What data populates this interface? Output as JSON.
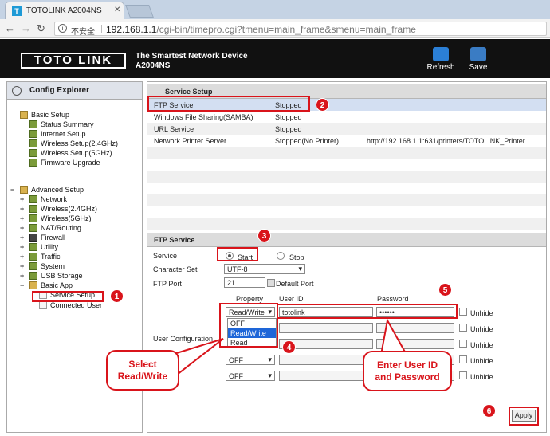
{
  "browser": {
    "tab_logo": "T",
    "tab_title": "TOTOLINK A2004NS",
    "tab_close": "✕",
    "security_label": "不安全",
    "url_host": "192.168.1.1",
    "url_path": "/cgi-bin/timepro.cgi?tmenu=main_frame&smenu=main_frame"
  },
  "header": {
    "logo": "TOTO LINK",
    "slogan": "The Smartest Network Device",
    "model": "A2004NS",
    "refresh_label": "Refresh",
    "save_label": "Save"
  },
  "sidebar": {
    "title": "Config Explorer",
    "basic_setup": "Basic Setup",
    "basic_items": [
      "Status Summary",
      "Internet Setup",
      "Wireless Setup(2.4GHz)",
      "Wireless Setup(5GHz)",
      "Firmware Upgrade"
    ],
    "advanced_setup": "Advanced Setup",
    "advanced_items": [
      "Network",
      "Wireless(2.4GHz)",
      "Wireless(5GHz)",
      "NAT/Routing",
      "Firewall",
      "Utility",
      "Traffic",
      "System",
      "USB Storage"
    ],
    "basic_app": "Basic App",
    "app_items": [
      "Service Setup",
      "Connected User"
    ],
    "plus": "+",
    "minus": "−"
  },
  "service_setup": {
    "title": "Service Setup",
    "rows": [
      {
        "name": "FTP Service",
        "status": "Stopped",
        "extra": ""
      },
      {
        "name": "Windows File Sharing(SAMBA)",
        "status": "Stopped",
        "extra": ""
      },
      {
        "name": "URL Service",
        "status": "Stopped",
        "extra": ""
      },
      {
        "name": "Network Printer Server",
        "status": "Stopped(No Printer)",
        "extra": "http://192.168.1.1:631/printers/TOTOLINK_Printer"
      }
    ]
  },
  "ftp": {
    "title": "FTP Service",
    "service_label": "Service",
    "start_label": "Start",
    "stop_label": "Stop",
    "charset_label": "Character Set",
    "charset_value": "UTF-8",
    "port_label": "FTP Port",
    "port_value": "21",
    "default_port_label": "Default Port",
    "col_property": "Property",
    "col_userid": "User ID",
    "col_password": "Password",
    "user_config_label": "User Configuration",
    "row1_property": "Read/Write",
    "row1_userid": "totolink",
    "row1_password": "••••••",
    "unhide_label": "Unhide",
    "dropdown_options": [
      "OFF",
      "Read/Write",
      "Read"
    ],
    "off_label": "OFF",
    "apply_label": "Apply"
  },
  "annotations": {
    "n1": "1",
    "n2": "2",
    "n3": "3",
    "n4": "4",
    "n5": "5",
    "n6": "6",
    "callout_left_1": "Select",
    "callout_left_2": "Read/Write",
    "callout_right_1": "Enter User ID",
    "callout_right_2": "and Password",
    "accent_color": "#d9141b"
  }
}
